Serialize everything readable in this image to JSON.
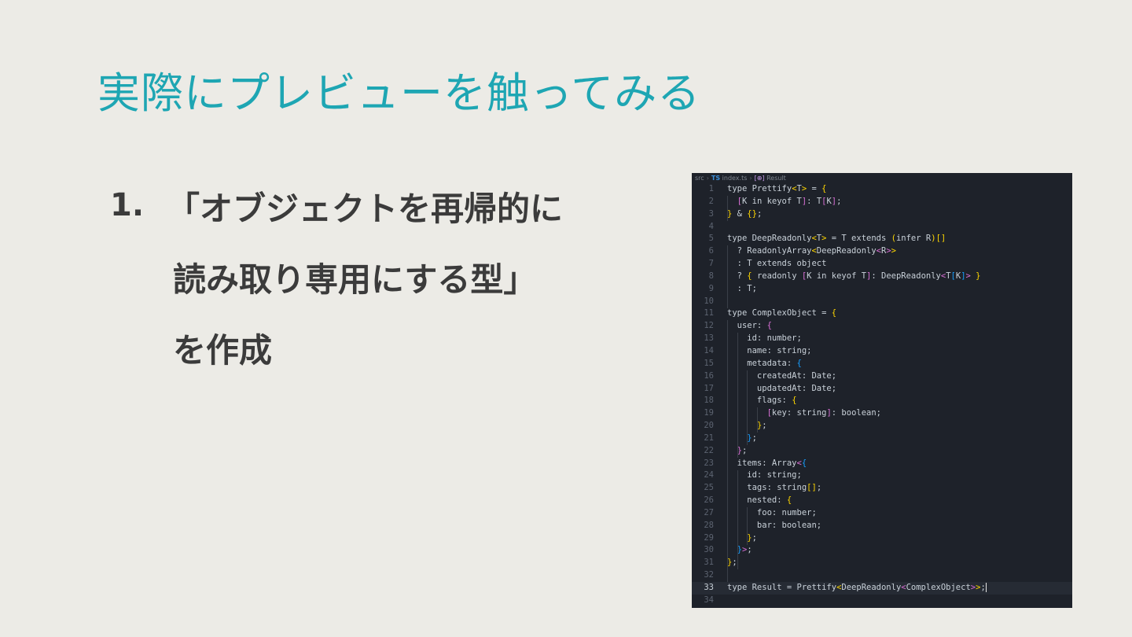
{
  "slide": {
    "title": "実際にプレビューを触ってみる",
    "item_number": "1.",
    "item_lines": [
      "「オブジェクトを再帰的に",
      "読み取り専用にする型」",
      "を作成"
    ]
  },
  "editor": {
    "breadcrumb": {
      "folder": "src",
      "lang": "TS",
      "file": "index.ts",
      "symbol_icon": "[⊕]",
      "symbol": "Result"
    },
    "lines": [
      "type Prettify<T> = {",
      "  [K in keyof T]: T[K];",
      "} & {};",
      "",
      "type DeepReadonly<T> = T extends (infer R)[]",
      "  ? ReadonlyArray<DeepReadonly<R>>",
      "  : T extends object",
      "  ? { readonly [K in keyof T]: DeepReadonly<T[K]> }",
      "  : T;",
      "",
      "type ComplexObject = {",
      "  user: {",
      "    id: number;",
      "    name: string;",
      "    metadata: {",
      "      createdAt: Date;",
      "      updatedAt: Date;",
      "      flags: {",
      "        [key: string]: boolean;",
      "      };",
      "    };",
      "  };",
      "  items: Array<{",
      "    id: string;",
      "    tags: string[];",
      "    nested: {",
      "      foo: number;",
      "      bar: boolean;",
      "    };",
      "  }>;",
      "};",
      "",
      "type Result = Prettify<DeepReadonly<ComplexObject>>;",
      ""
    ],
    "current_line": 33,
    "colors": {
      "bracket_yellow": "#ffd700",
      "bracket_pink": "#da70d6",
      "bracket_blue": "#179fff",
      "ident": "#c9d1d9"
    }
  }
}
